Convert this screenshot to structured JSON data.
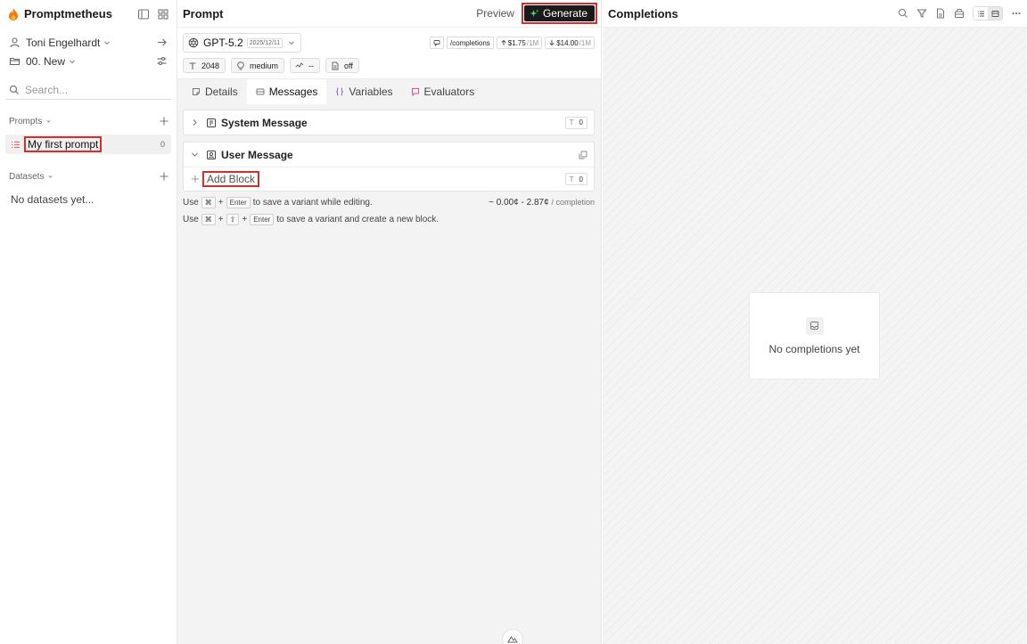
{
  "sidebar": {
    "app_title": "Promptmetheus",
    "user_name": "Toni Engelhardt",
    "project_name": "00. New",
    "search_placeholder": "Search...",
    "prompts_label": "Prompts",
    "prompts": [
      {
        "name": "My first prompt",
        "count": "0"
      }
    ],
    "datasets_label": "Datasets",
    "datasets_empty": "No datasets yet..."
  },
  "prompt_panel": {
    "title": "Prompt",
    "preview_label": "Preview",
    "generate_label": "Generate",
    "model": {
      "name": "GPT-5.2",
      "date": "2025/12/11",
      "endpoint": "/completions",
      "input_price": "$1.75",
      "input_unit": "/1M",
      "output_price": "$14.00",
      "output_unit": "/1M"
    },
    "params": {
      "max_tokens": "2048",
      "reasoning": "medium",
      "temperature": "--",
      "format": "off"
    },
    "tabs": [
      {
        "label": "Details"
      },
      {
        "label": "Messages"
      },
      {
        "label": "Variables"
      },
      {
        "label": "Evaluators"
      }
    ],
    "system_message": {
      "title": "System Message",
      "tokens": "0"
    },
    "user_message": {
      "title": "User Message",
      "add_block_label": "Add Block",
      "tokens": "0"
    },
    "hint1": {
      "prefix": "Use",
      "key1": "⌘",
      "plus": "+",
      "key2": "Enter",
      "suffix": "to save a variant while editing."
    },
    "hint2": {
      "prefix": "Use",
      "key1": "⌘",
      "plus": "+",
      "key2": "⇧",
      "key3": "Enter",
      "suffix": "to save a variant and create a new block."
    },
    "cost": {
      "range": "~ 0.00¢ - 2.87¢",
      "unit": "/ completion"
    },
    "token_glyph": "T"
  },
  "completions_panel": {
    "title": "Completions",
    "empty_text": "No completions yet"
  },
  "colors": {
    "accent_red": "#d32f2f",
    "generate_bg": "#1a1a1a",
    "spark_green": "#4ade80"
  }
}
